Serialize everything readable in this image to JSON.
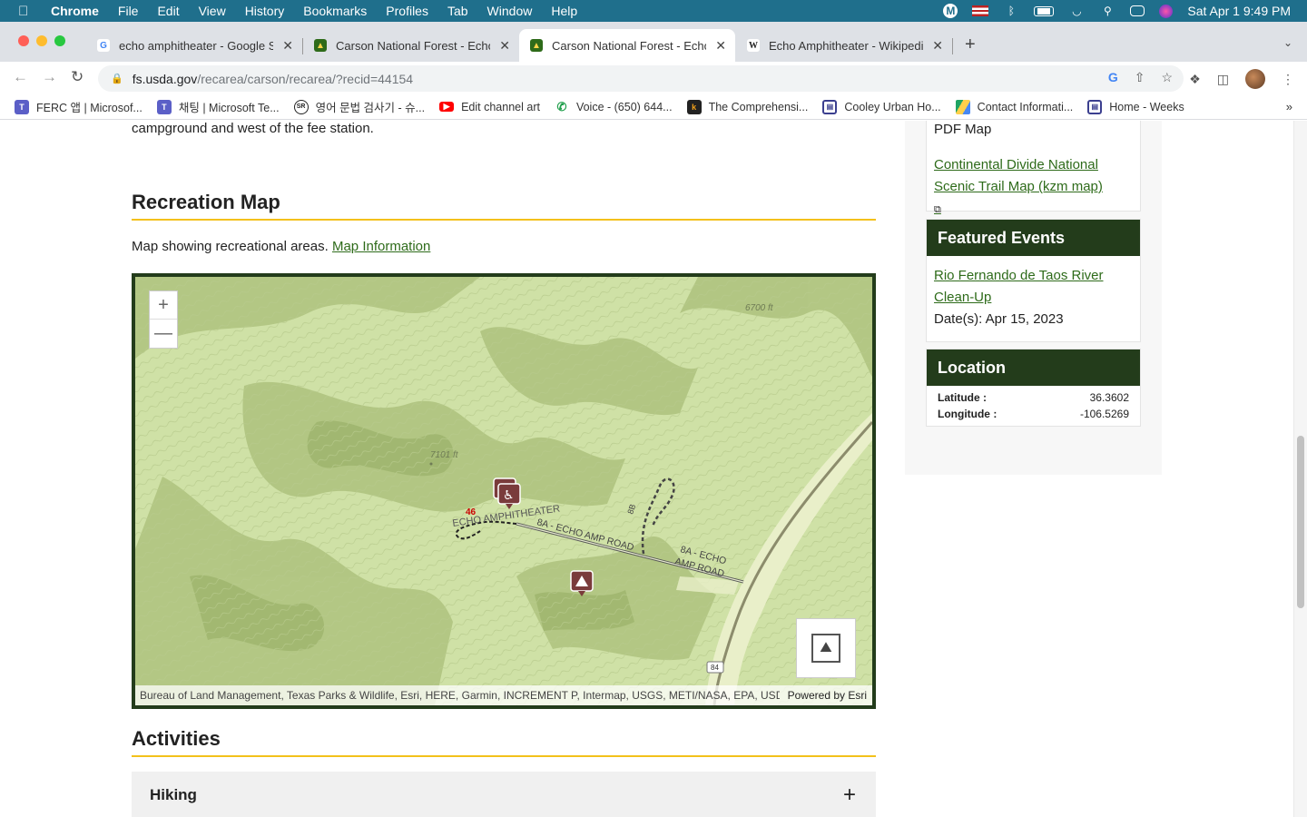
{
  "menubar": {
    "app": "Chrome",
    "items": [
      "File",
      "Edit",
      "View",
      "History",
      "Bookmarks",
      "Profiles",
      "Tab",
      "Window",
      "Help"
    ],
    "datetime": "Sat Apr 1  9:49 PM"
  },
  "tabs": [
    {
      "title": "echo amphitheater - Google Se",
      "favicon": "G"
    },
    {
      "title": "Carson National Forest - Echo A",
      "favicon": "shield"
    },
    {
      "title": "Carson National Forest - Echo A",
      "favicon": "shield"
    },
    {
      "title": "Echo Amphitheater - Wikipedia",
      "favicon": "W"
    }
  ],
  "address": {
    "host": "fs.usda.gov",
    "path": "/recarea/carson/recarea/?recid=44154"
  },
  "bookmarks": [
    "FERC 앱 | Microsof...",
    "채팅 | Microsoft Te...",
    "영어 문법 검사기 - 슈...",
    "Edit channel art",
    "Voice - (650) 644...",
    "The Comprehensi...",
    "Cooley Urban Ho...",
    "Contact Informati...",
    "Home - Weeks"
  ],
  "page": {
    "intro_tail": "campground and west of the fee station.",
    "map_section_title": "Recreation Map",
    "map_desc": "Map showing recreational areas.",
    "map_info_link": "Map Information",
    "map": {
      "zoom_in": "+",
      "zoom_out": "—",
      "labels": {
        "elev1": "6700 ft",
        "elev2": "7101 ft",
        "site": "ECHO AMPHITHEATER",
        "site_num": "46",
        "road1": "8A - ECHO AMP ROAD",
        "road2a": "8A - ECHO",
        "road2b": "AMP ROAD",
        "road3": "8B",
        "highway": "84"
      },
      "attribution": "Bureau of Land Management, Texas Parks & Wildlife, Esri, HERE, Garmin, INCREMENT P, Intermap, USGS, METI/NASA, EPA, USDA | The ...",
      "powered_by": "Powered by Esri"
    },
    "activities_title": "Activities",
    "activity_item": "Hiking"
  },
  "sidebar": {
    "pdf_map": "PDF Map",
    "cdt_link": "Continental Divide National Scenic Trail Map (kzm map)",
    "featured_title": "Featured Events",
    "event_link": "Rio Fernando de Taos River Clean-Up",
    "event_date": "Date(s): Apr 15, 2023",
    "location_title": "Location",
    "latitude_label": "Latitude :",
    "latitude_value": "36.3602",
    "longitude_label": "Longitude :",
    "longitude_value": "-106.5269"
  }
}
